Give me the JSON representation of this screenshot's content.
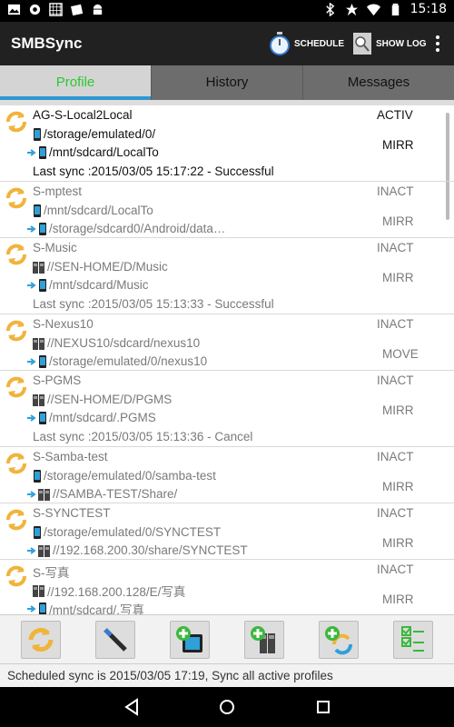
{
  "status_bar": {
    "time": "15:18",
    "left_icons": [
      "photo-icon",
      "settings-icon",
      "calendar-icon",
      "file-icon",
      "android-icon"
    ],
    "right_icons": [
      "bluetooth-icon",
      "star-icon",
      "wifi-icon",
      "battery-icon"
    ]
  },
  "action_bar": {
    "title": "SMBSync",
    "schedule_label": "SCHEDULE",
    "show_log_label": "SHOW LOG"
  },
  "tabs": [
    {
      "label": "Profile",
      "active": true
    },
    {
      "label": "History",
      "active": false
    },
    {
      "label": "Messages",
      "active": false
    }
  ],
  "profiles": [
    {
      "name": "AG-S-Local2Local",
      "status": "ACTIV",
      "src_type": "local",
      "source": "/storage/emulated/0/",
      "dst_type": "local",
      "target": "/mnt/sdcard/LocalTo",
      "mode": "MIRR",
      "last_sync": "Last sync :2015/03/05 15:17:22 - Successful",
      "active": true
    },
    {
      "name": "S-mptest",
      "status": "INACT",
      "src_type": "local",
      "source": "/mnt/sdcard/LocalTo",
      "dst_type": "local",
      "target": "/storage/sdcard0/Android/data…",
      "mode": "MIRR",
      "last_sync": "",
      "active": false
    },
    {
      "name": "S-Music",
      "status": "INACT",
      "src_type": "remote",
      "source": "//SEN-HOME/D/Music",
      "dst_type": "local",
      "target": "/mnt/sdcard/Music",
      "mode": "MIRR",
      "last_sync": "Last sync :2015/03/05 15:13:33 - Successful",
      "active": false
    },
    {
      "name": "S-Nexus10",
      "status": "INACT",
      "src_type": "remote",
      "source": "//NEXUS10/sdcard/nexus10",
      "dst_type": "local",
      "target": "/storage/emulated/0/nexus10",
      "mode": "MOVE",
      "last_sync": "",
      "active": false
    },
    {
      "name": "S-PGMS",
      "status": "INACT",
      "src_type": "remote",
      "source": "//SEN-HOME/D/PGMS",
      "dst_type": "local",
      "target": "/mnt/sdcard/.PGMS",
      "mode": "MIRR",
      "last_sync": "Last sync :2015/03/05 15:13:36 - Cancel",
      "active": false
    },
    {
      "name": "S-Samba-test",
      "status": "INACT",
      "src_type": "local",
      "source": "/storage/emulated/0/samba-test",
      "dst_type": "remote",
      "target": "//SAMBA-TEST/Share/",
      "mode": "MIRR",
      "last_sync": "",
      "active": false
    },
    {
      "name": "S-SYNCTEST",
      "status": "INACT",
      "src_type": "local",
      "source": "/storage/emulated/0/SYNCTEST",
      "dst_type": "remote",
      "target": "//192.168.200.30/share/SYNCTEST",
      "mode": "MIRR",
      "last_sync": "",
      "active": false
    },
    {
      "name": "S-写真",
      "status": "INACT",
      "src_type": "remote",
      "source": "//192.168.200.128/E/写真",
      "dst_type": "local",
      "target": "/mnt/sdcard/.写真",
      "mode": "MIRR",
      "last_sync": "",
      "active": false
    }
  ],
  "toolbar": {
    "buttons": [
      "sync-all-icon",
      "edit-tools-icon",
      "add-local-profile-icon",
      "add-remote-profile-icon",
      "add-sync-profile-icon",
      "select-checklist-icon"
    ]
  },
  "message_bar": {
    "text": "Scheduled sync is 2015/03/05 17:19, Sync all active profiles"
  },
  "colors": {
    "active_tab_text": "#2ec832",
    "tab_indicator": "#2f97d0",
    "action_bar": "#212121",
    "sync_icon": "#f0b43c"
  }
}
